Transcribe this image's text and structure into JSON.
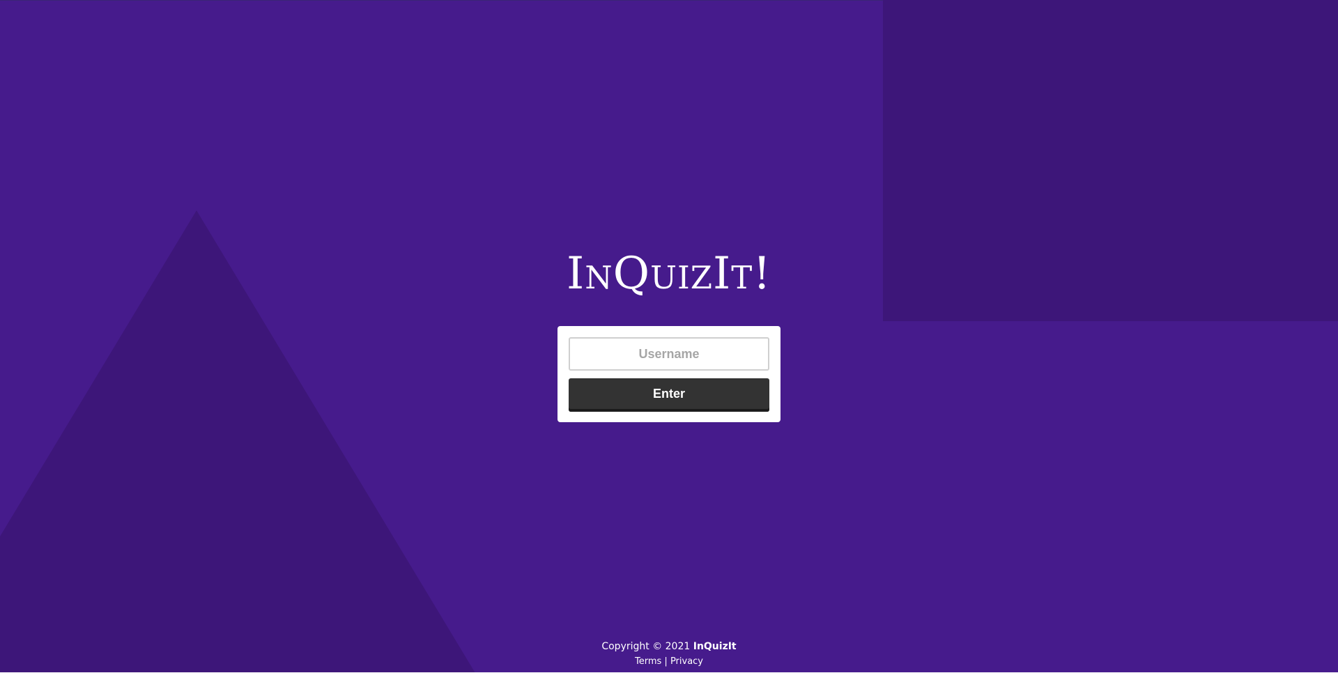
{
  "colors": {
    "background": "#461b8c",
    "shape": "#3d1679",
    "card": "#ffffff",
    "button": "#333333"
  },
  "logo": {
    "text": "InQuizIt!"
  },
  "login": {
    "username_placeholder": "Username",
    "username_value": "",
    "enter_label": "Enter"
  },
  "footer": {
    "copyright": "Copyright © 2021 ",
    "brand": "InQuizIt",
    "terms": "Terms",
    "separator": " | ",
    "privacy": "Privacy"
  }
}
